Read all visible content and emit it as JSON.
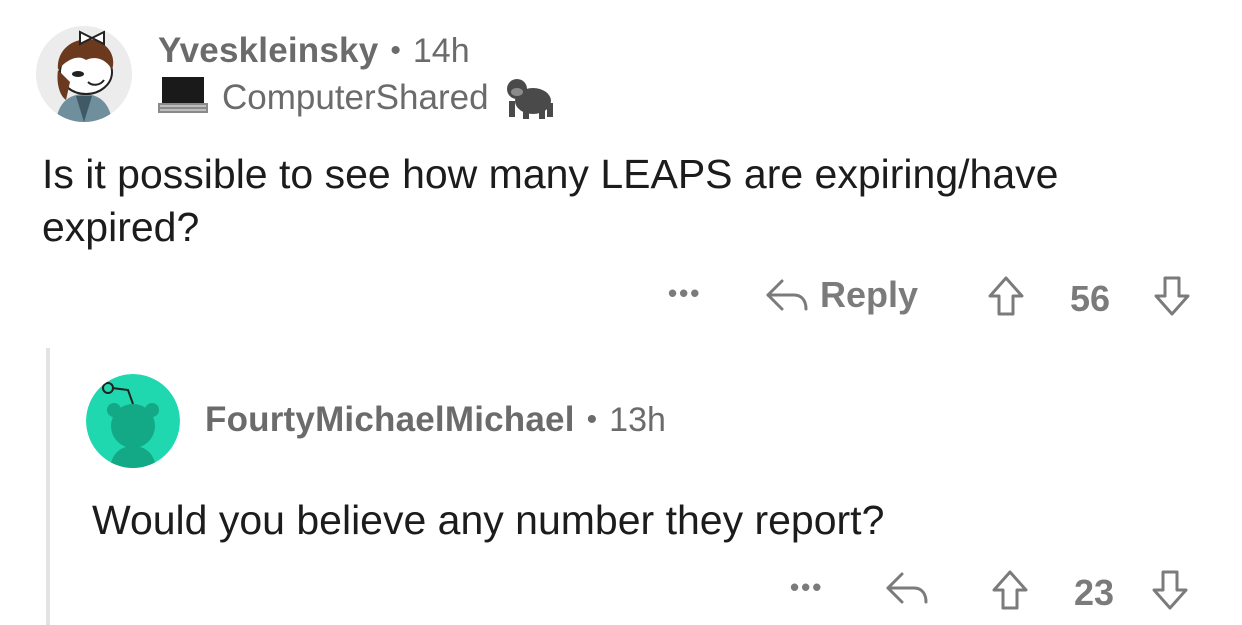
{
  "comment": {
    "username": "Yveskleinsky",
    "separator": "•",
    "time": "14h",
    "flair": "ComputerShared",
    "body": "Is it possible to see how many LEAPS are expiring/have expired?",
    "actions": {
      "more": "•••",
      "reply_label": "Reply",
      "score": "56"
    }
  },
  "reply": {
    "username": "FourtyMichaelMichael",
    "separator": "•",
    "time": "13h",
    "body": "Would you believe any number they report?",
    "actions": {
      "more": "•••",
      "score": "23"
    }
  },
  "colors": {
    "meta_text": "#6b6b6b",
    "body_text": "#1c1c1c",
    "action_icon": "#7b7b7b",
    "reply_avatar_bg": "#1fd8b0",
    "thread_line": "#e3e3e3"
  },
  "icons": [
    "user-avatar-icon",
    "laptop-icon",
    "gorilla-icon",
    "reply-arrow-icon",
    "upvote-icon",
    "downvote-icon",
    "more-options-icon"
  ]
}
